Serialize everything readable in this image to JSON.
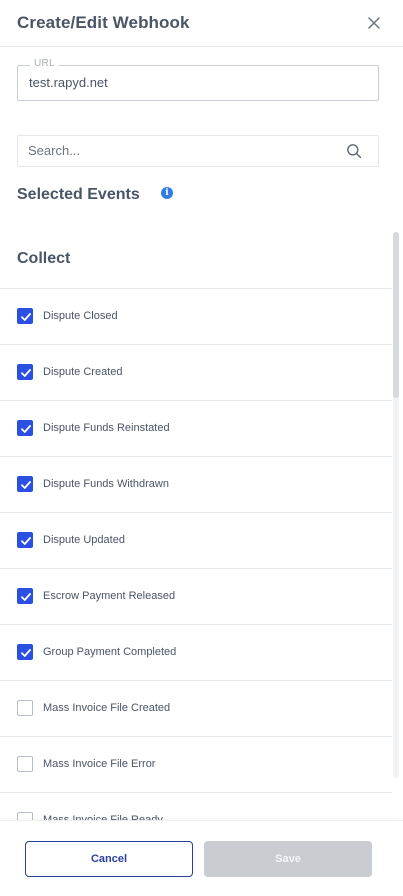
{
  "header": {
    "title": "Create/Edit Webhook",
    "close_icon": "close-icon"
  },
  "url_field": {
    "legend": "URL",
    "value": "test.rapyd.net"
  },
  "search": {
    "placeholder": "Search...",
    "icon": "search-icon"
  },
  "selected_events": {
    "title": "Selected Events",
    "info_icon": "i"
  },
  "group": {
    "title": "Collect",
    "events": [
      {
        "label": "Dispute Closed",
        "checked": true
      },
      {
        "label": "Dispute Created",
        "checked": true
      },
      {
        "label": "Dispute Funds Reinstated",
        "checked": true
      },
      {
        "label": "Dispute Funds Withdrawn",
        "checked": true
      },
      {
        "label": "Dispute Updated",
        "checked": true
      },
      {
        "label": "Escrow Payment Released",
        "checked": true
      },
      {
        "label": "Group Payment Completed",
        "checked": true
      },
      {
        "label": "Mass Invoice File Created",
        "checked": false
      },
      {
        "label": "Mass Invoice File Error",
        "checked": false
      },
      {
        "label": "Mass Invoice File Ready",
        "checked": false
      }
    ]
  },
  "footer": {
    "cancel_label": "Cancel",
    "save_label": "Save"
  },
  "colors": {
    "accent": "#2b4fe0",
    "button_border": "#2a3f9f",
    "disabled": "#c9ccd1",
    "info": "#2f7de1"
  }
}
